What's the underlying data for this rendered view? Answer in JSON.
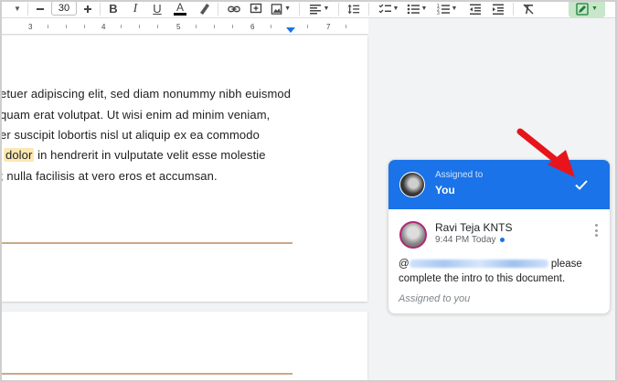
{
  "toolbar": {
    "font_size": "30",
    "icons": [
      "caret-down-icon",
      "minus-icon",
      "plus-icon",
      "bold-icon",
      "italic-icon",
      "underline-icon",
      "text-color-icon",
      "highlight-icon",
      "link-icon",
      "add-comment-icon",
      "insert-image-icon",
      "align-icon",
      "line-spacing-icon",
      "checklist-icon",
      "bulleted-list-icon",
      "numbered-list-icon",
      "decrease-indent-icon",
      "increase-indent-icon",
      "clear-formatting-icon",
      "editing-mode-icon"
    ],
    "bold_glyph": "B",
    "italic_glyph": "I",
    "underline_glyph": "U",
    "text_color_glyph": "A"
  },
  "ruler": {
    "numbers": [
      "3",
      "4",
      "5",
      "6",
      "7"
    ]
  },
  "document": {
    "lines": [
      {
        "before": "etuer adipiscing elit, sed diam nonummy nibh euismod",
        "highlight": "",
        "after": ""
      },
      {
        "before": "quam erat volutpat. Ut wisi enim ad minim veniam,",
        "highlight": "",
        "after": ""
      },
      {
        "before": "er suscipit lobortis nisl ut aliquip ex ea commodo",
        "highlight": "",
        "after": ""
      },
      {
        "before": "",
        "highlight": "dolor",
        "after": " in hendrerit in vulputate velit esse molestie"
      },
      {
        "before": "; nulla facilisis at vero eros et accumsan.",
        "highlight": "",
        "after": ""
      }
    ]
  },
  "comment": {
    "assigned_label": "Assigned to",
    "assigned_name": "You",
    "author": "Ravi Teja KNTS",
    "time": "9:44 PM Today",
    "mention_prefix": "@",
    "mention_suffix": " please",
    "text_rest": "complete the intro to this document.",
    "footer": "Assigned to you"
  },
  "colors": {
    "accent": "#1a73e8",
    "highlight": "#fce8b2",
    "arrow": "#e8141b"
  }
}
